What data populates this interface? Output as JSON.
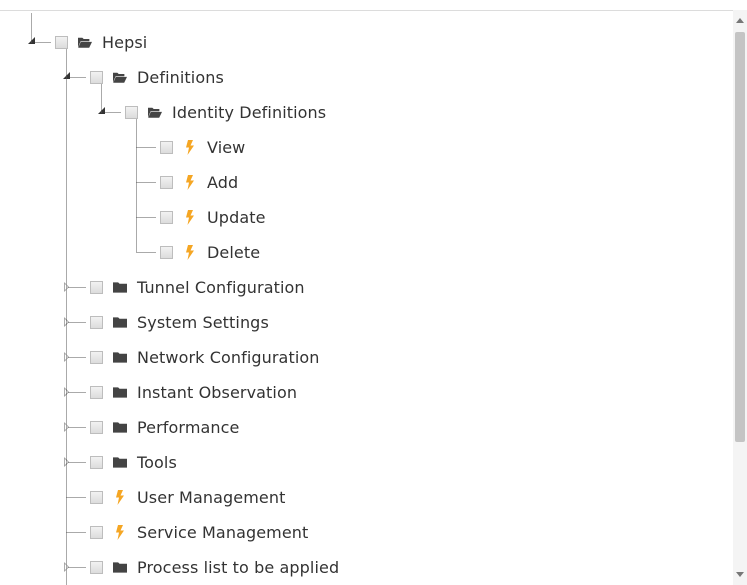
{
  "tree": {
    "nodes": [
      {
        "label": "Hepsi",
        "icon": "folder-open-icon",
        "depth": 0,
        "expander": "expanded"
      },
      {
        "label": "Definitions",
        "icon": "folder-open-icon",
        "depth": 1,
        "expander": "expanded"
      },
      {
        "label": "Identity Definitions",
        "icon": "folder-open-icon",
        "depth": 2,
        "expander": "expanded"
      },
      {
        "label": "View",
        "icon": "bolt-icon",
        "depth": 3,
        "expander": "none"
      },
      {
        "label": "Add",
        "icon": "bolt-icon",
        "depth": 3,
        "expander": "none"
      },
      {
        "label": "Update",
        "icon": "bolt-icon",
        "depth": 3,
        "expander": "none"
      },
      {
        "label": "Delete",
        "icon": "bolt-icon",
        "depth": 3,
        "expander": "none"
      },
      {
        "label": "Tunnel Configuration",
        "icon": "folder-icon",
        "depth": 1,
        "expander": "collapsed"
      },
      {
        "label": "System Settings",
        "icon": "folder-icon",
        "depth": 1,
        "expander": "collapsed"
      },
      {
        "label": "Network Configuration",
        "icon": "folder-icon",
        "depth": 1,
        "expander": "collapsed"
      },
      {
        "label": "Instant Observation",
        "icon": "folder-icon",
        "depth": 1,
        "expander": "collapsed"
      },
      {
        "label": "Performance",
        "icon": "folder-icon",
        "depth": 1,
        "expander": "collapsed"
      },
      {
        "label": "Tools",
        "icon": "folder-icon",
        "depth": 1,
        "expander": "collapsed"
      },
      {
        "label": "User Management",
        "icon": "bolt-icon",
        "depth": 1,
        "expander": "none"
      },
      {
        "label": "Service Management",
        "icon": "bolt-icon",
        "depth": 1,
        "expander": "none"
      },
      {
        "label": "Process list to be applied",
        "icon": "folder-icon",
        "depth": 1,
        "expander": "collapsed"
      }
    ]
  },
  "colors": {
    "bolt": "#f5a623",
    "folder": "#444444",
    "text": "#333333",
    "guide_line": "#555555"
  }
}
